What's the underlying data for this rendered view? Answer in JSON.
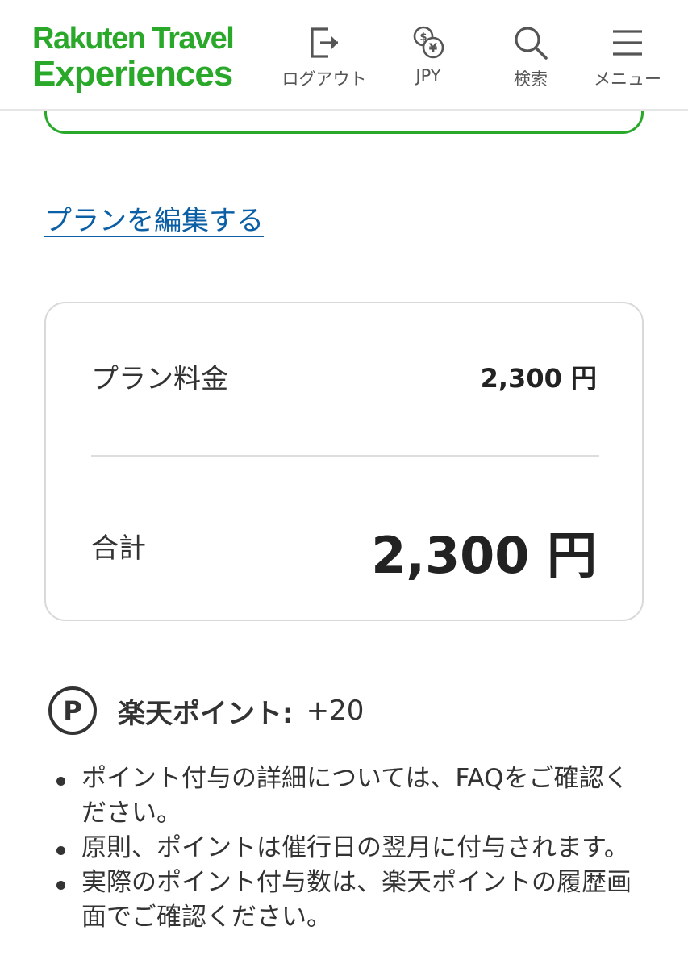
{
  "header": {
    "logo_line1": "Rakuten Travel",
    "logo_line2": "Experiences",
    "brand_color": "#2aa82a",
    "nav": {
      "logout": {
        "label": "ログアウト",
        "icon": "logout-icon"
      },
      "currency": {
        "label": "JPY",
        "icon": "currency-exchange-icon"
      },
      "search": {
        "label": "検索",
        "icon": "search-icon"
      },
      "menu": {
        "label": "メニュー",
        "icon": "hamburger-menu-icon"
      }
    }
  },
  "edit_plan_link": "プランを編集する",
  "price_summary": {
    "plan_fee_label": "プラン料金",
    "plan_fee_value": "2,300 円",
    "total_label": "合計",
    "total_value": "2,300 円"
  },
  "points": {
    "icon_letter": "P",
    "label": "楽天ポイント:",
    "value": "+20"
  },
  "notes": [
    "ポイント付与の詳細については、FAQをご確認ください。",
    "原則、ポイントは催行日の翌月に付与されます。",
    "実際のポイント付与数は、楽天ポイントの履歴画面でご確認ください。"
  ],
  "colors": {
    "link": "#0b5fa5",
    "text": "#333333",
    "border": "#d9d9d9"
  }
}
